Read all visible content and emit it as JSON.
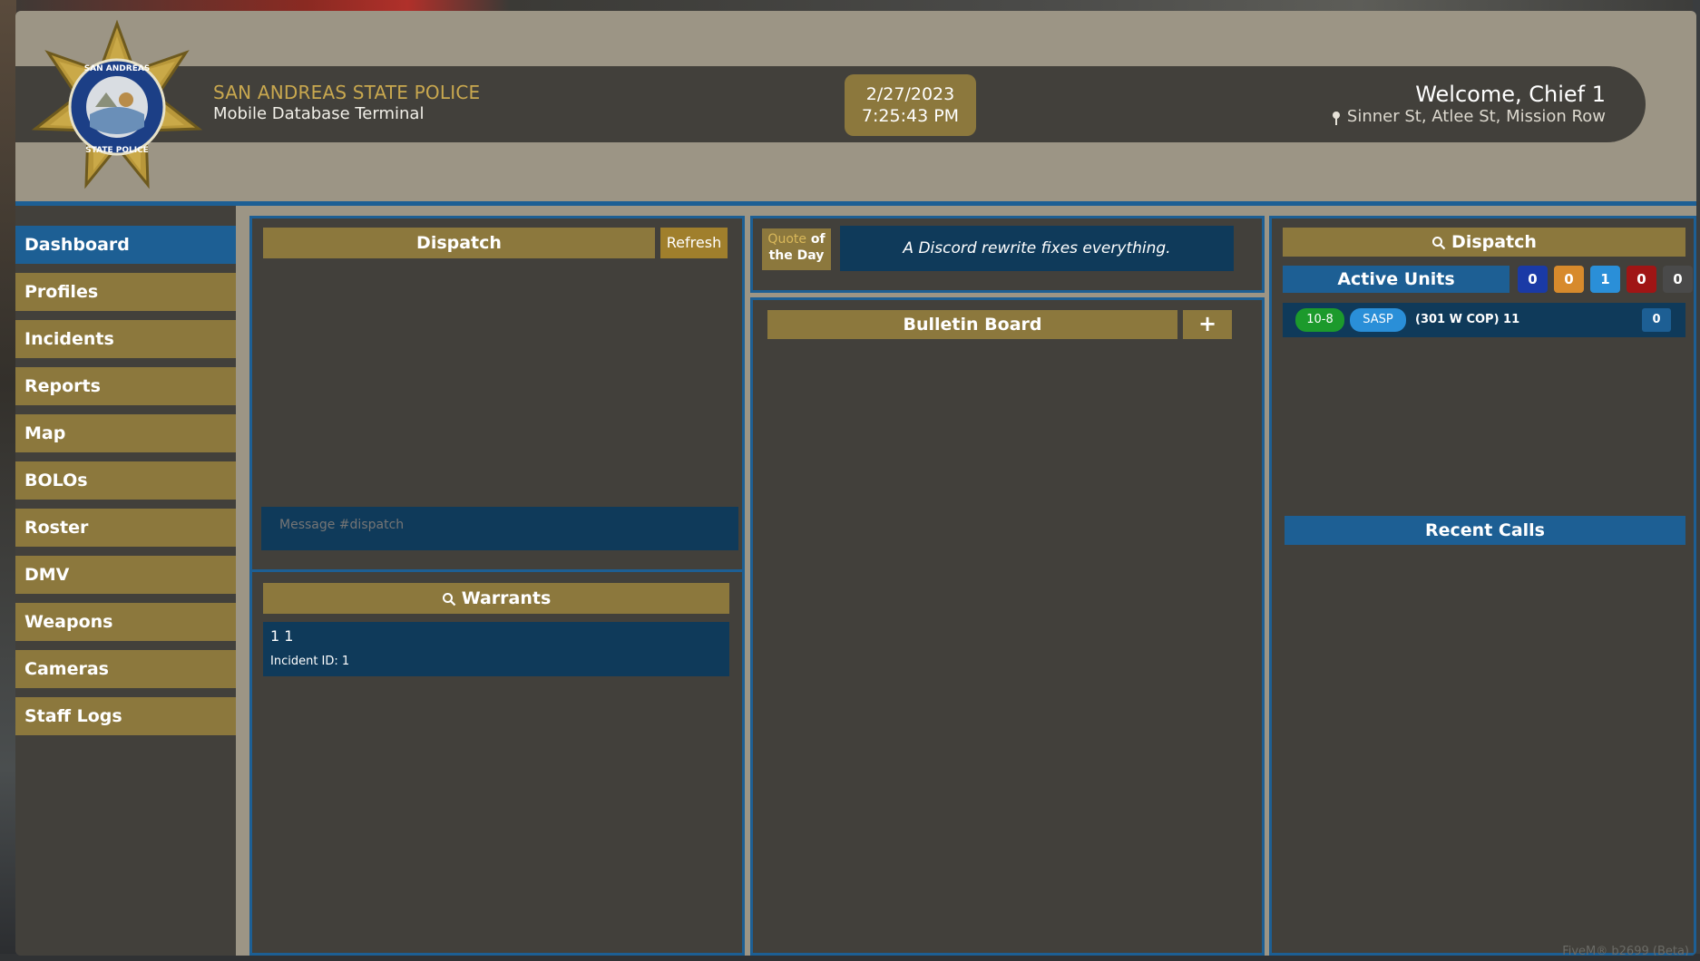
{
  "header": {
    "agency": "SAN ANDREAS STATE POLICE",
    "subtitle": "Mobile Database Terminal",
    "date": "2/27/2023",
    "time": "7:25:43 PM",
    "welcome": "Welcome, Chief 1",
    "location": "Sinner St, Atlee St, Mission Row",
    "badge_text": "SAN ANDREAS STATE POLICE"
  },
  "sidebar": {
    "items": [
      {
        "label": "Dashboard",
        "active": true
      },
      {
        "label": "Profiles"
      },
      {
        "label": "Incidents"
      },
      {
        "label": "Reports"
      },
      {
        "label": "Map"
      },
      {
        "label": "BOLOs"
      },
      {
        "label": "Roster"
      },
      {
        "label": "DMV"
      },
      {
        "label": "Weapons"
      },
      {
        "label": "Cameras"
      },
      {
        "label": "Staff Logs"
      }
    ]
  },
  "dispatch": {
    "title": "Dispatch",
    "refresh_label": "Refresh",
    "message_placeholder": "Message #dispatch"
  },
  "warrants": {
    "title": "Warrants",
    "items": [
      {
        "name": "1 1",
        "incident": "Incident ID: 1"
      }
    ]
  },
  "quote": {
    "label_quote": "Quote",
    "label_of": "of",
    "label_the_day": "the Day",
    "text": "A Discord rewrite fixes everything."
  },
  "bulletin": {
    "title": "Bulletin Board",
    "add_label": "+"
  },
  "units": {
    "search_title": "Dispatch",
    "active_title": "Active Units",
    "counts": [
      {
        "value": "0",
        "color": "#1a3aa6"
      },
      {
        "value": "0",
        "color": "#d78a2c"
      },
      {
        "value": "1",
        "color": "#2a8fd8"
      },
      {
        "value": "0",
        "color": "#a01515"
      },
      {
        "value": "0",
        "color": "#4a4a4a"
      }
    ],
    "rows": [
      {
        "status": "10-8",
        "dept": "SASP",
        "name": "(301 W COP) 11",
        "count": "0"
      }
    ],
    "recent_calls_title": "Recent Calls"
  },
  "footer": {
    "corner_text": "FiveM® b2699 (Beta)"
  },
  "colors": {
    "gold": "#8c783d",
    "blue": "#1d5f94",
    "panel": "#42403b",
    "frame": "#9c9585",
    "status_green": "#1c9a2c",
    "dept_blue": "#2a8fd8"
  }
}
